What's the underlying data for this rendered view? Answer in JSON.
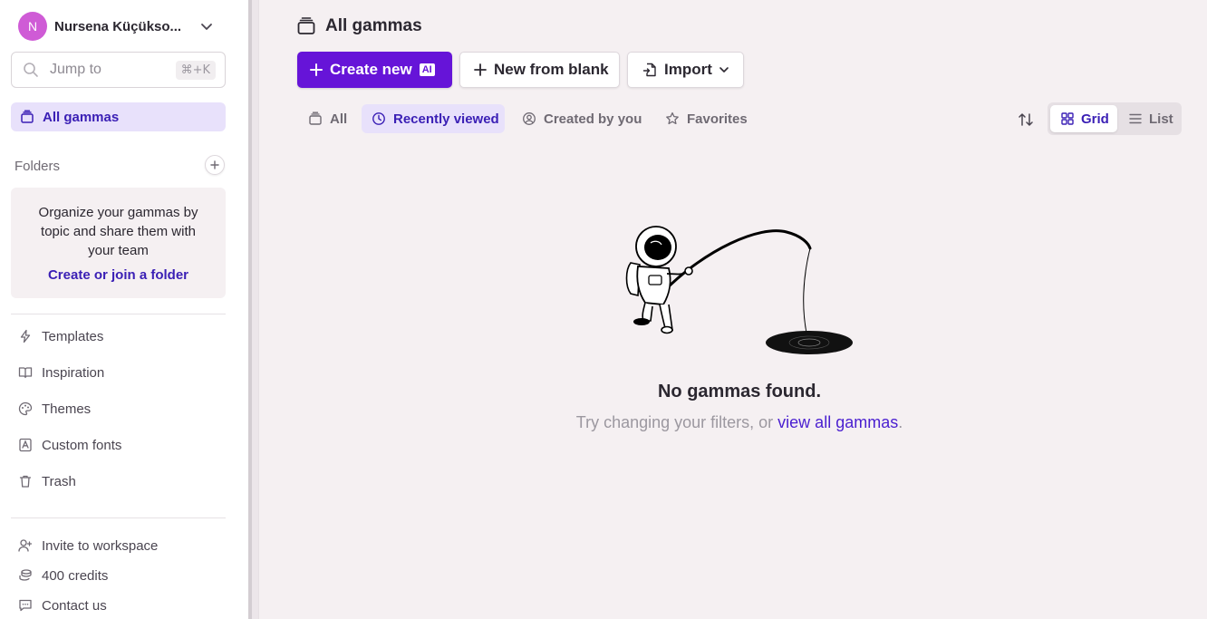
{
  "account": {
    "initial": "N",
    "name": "Nursena Küçükso..."
  },
  "search": {
    "placeholder": "Jump to",
    "shortcut": "⌘+K"
  },
  "nav": {
    "all_gammas": "All gammas"
  },
  "folders": {
    "header": "Folders",
    "empty_text": "Organize your gammas by topic and share them with your team",
    "create_link": "Create or join a folder"
  },
  "sidebar_links": [
    {
      "label": "Templates",
      "icon": "bolt-icon"
    },
    {
      "label": "Inspiration",
      "icon": "book-icon"
    },
    {
      "label": "Themes",
      "icon": "palette-icon"
    },
    {
      "label": "Custom fonts",
      "icon": "font-icon"
    },
    {
      "label": "Trash",
      "icon": "trash-icon"
    }
  ],
  "footer_links": [
    {
      "label": "Invite to workspace",
      "icon": "user-plus-icon"
    },
    {
      "label": "400 credits",
      "icon": "coins-icon"
    },
    {
      "label": "Contact us",
      "icon": "message-icon"
    }
  ],
  "main": {
    "title": "All gammas",
    "buttons": {
      "create": "Create new",
      "create_badge": "AI",
      "blank": "New from blank",
      "import": "Import"
    },
    "tabs": [
      {
        "label": "All",
        "active": false
      },
      {
        "label": "Recently viewed",
        "active": true
      },
      {
        "label": "Created by you",
        "active": false
      },
      {
        "label": "Favorites",
        "active": false
      }
    ],
    "view": {
      "grid": "Grid",
      "list": "List",
      "selected": "Grid"
    },
    "empty": {
      "title": "No gammas found.",
      "message": "Try changing your filters, or ",
      "link": "view all gammas",
      "suffix": "."
    }
  },
  "colors": {
    "accent": "#6614d8",
    "accent_text": "#3a1fb5",
    "selected_bg": "#e8e1fb",
    "page_bg": "#f5f0f2"
  }
}
